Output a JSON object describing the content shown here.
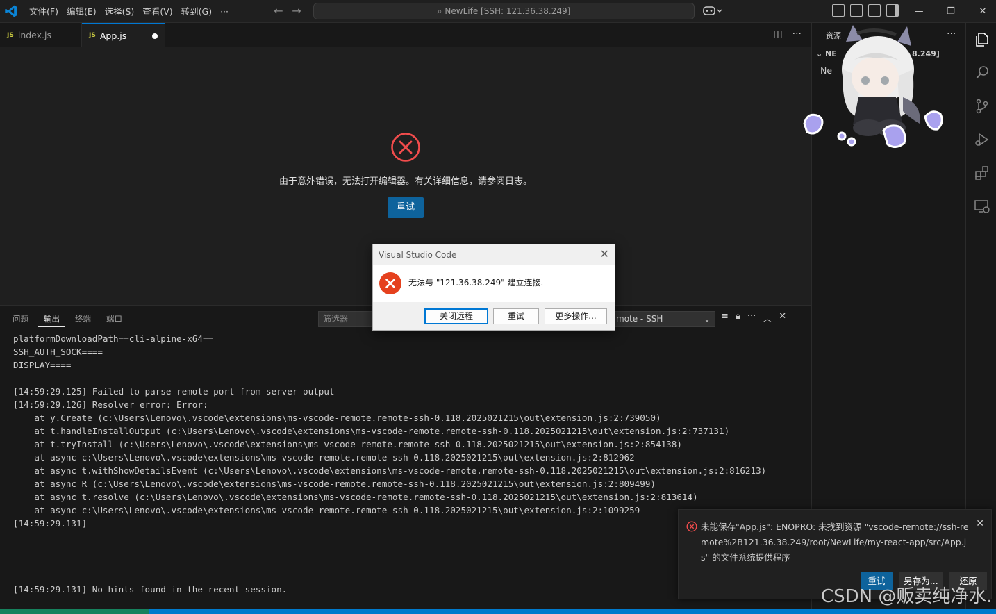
{
  "titlebar": {
    "menu": [
      "文件(F)",
      "编辑(E)",
      "选择(S)",
      "查看(V)",
      "转到(G)",
      "···"
    ],
    "search_text": "NewLife [SSH: 121.36.38.249]"
  },
  "tabs": [
    {
      "icon": "JS",
      "label": "index.js"
    },
    {
      "icon": "JS",
      "label": "App.js",
      "dirty": true
    }
  ],
  "editor": {
    "error_message": "由于意外错误，无法打开编辑器。有关详细信息，请参阅日志。",
    "retry_label": "重试"
  },
  "panel": {
    "tabs": [
      "问题",
      "输出",
      "终端",
      "端口"
    ],
    "active_tab": "输出",
    "filter_placeholder": "筛选器",
    "channel": "mote - SSH",
    "output_lines": [
      "platformDownloadPath==cli-alpine-x64==",
      "SSH_AUTH_SOCK====",
      "DISPLAY====",
      "",
      "[14:59:29.125] Failed to parse remote port from server output",
      "[14:59:29.126] Resolver error: Error:",
      "    at y.Create (c:\\Users\\Lenovo\\.vscode\\extensions\\ms-vscode-remote.remote-ssh-0.118.2025021215\\out\\extension.js:2:739050)",
      "    at t.handleInstallOutput (c:\\Users\\Lenovo\\.vscode\\extensions\\ms-vscode-remote.remote-ssh-0.118.2025021215\\out\\extension.js:2:737131)",
      "    at t.tryInstall (c:\\Users\\Lenovo\\.vscode\\extensions\\ms-vscode-remote.remote-ssh-0.118.2025021215\\out\\extension.js:2:854138)",
      "    at async c:\\Users\\Lenovo\\.vscode\\extensions\\ms-vscode-remote.remote-ssh-0.118.2025021215\\out\\extension.js:2:812962",
      "    at async t.withShowDetailsEvent (c:\\Users\\Lenovo\\.vscode\\extensions\\ms-vscode-remote.remote-ssh-0.118.2025021215\\out\\extension.js:2:816213)",
      "    at async R (c:\\Users\\Lenovo\\.vscode\\extensions\\ms-vscode-remote.remote-ssh-0.118.2025021215\\out\\extension.js:2:809499)",
      "    at async t.resolve (c:\\Users\\Lenovo\\.vscode\\extensions\\ms-vscode-remote.remote-ssh-0.118.2025021215\\out\\extension.js:2:813614)",
      "    at async c:\\Users\\Lenovo\\.vscode\\extensions\\ms-vscode-remote.remote-ssh-0.118.2025021215\\out\\extension.js:2:1099259",
      "[14:59:29.131] ------",
      "",
      "",
      "",
      "",
      "[14:59:29.131] No hints found in the recent session."
    ]
  },
  "sidebar": {
    "title": "资源",
    "folder_prefix": "NE",
    "folder_suffix": "8.249]",
    "item": "Ne"
  },
  "dialog": {
    "title": "Visual Studio Code",
    "message": "无法与 \"121.36.38.249\" 建立连接.",
    "buttons": {
      "close_remote": "关闭远程",
      "retry": "重试",
      "more": "更多操作..."
    }
  },
  "notification": {
    "message": "未能保存\"App.js\": ENOPRO: 未找到资源 \"vscode-remote://ssh-remote%2B121.36.38.249/root/NewLife/my-react-app/src/App.js\" 的文件系统提供程序",
    "buttons": {
      "retry": "重试",
      "save_as": "另存为...",
      "revert": "还原"
    }
  },
  "watermark": "CSDN @贩卖纯净水.",
  "colors": {
    "accent": "#0e639c",
    "error": "#e51400",
    "dialog_error": "#e74c3c"
  }
}
